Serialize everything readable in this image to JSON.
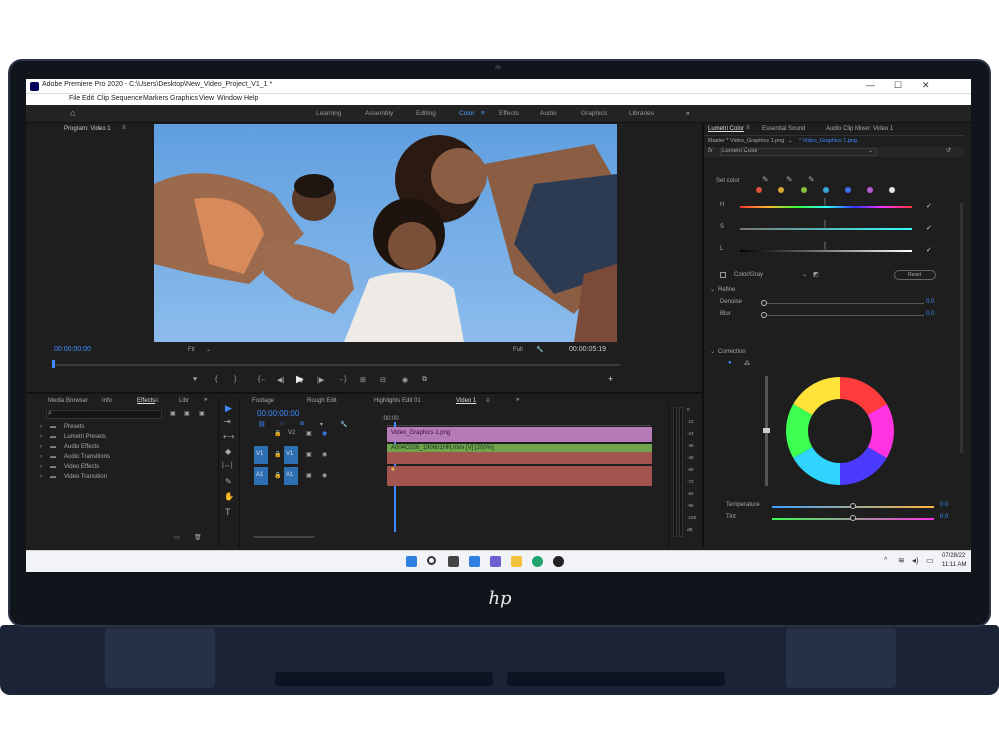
{
  "app": {
    "title": "Adobe Premiere Pro 2020 - C:\\Users\\Desktop\\New_Video_Project_V1_1 *",
    "window_controls": [
      "—",
      "☐",
      "✕"
    ]
  },
  "menu": [
    "File",
    "Edit",
    "Clip",
    "Sequence",
    "Markers",
    "Graphics",
    "View",
    "Window",
    "Help"
  ],
  "workspaces": {
    "items": [
      "Learning",
      "Assembly",
      "Editing",
      "Color",
      "Effects",
      "Audio",
      "Graphics",
      "Libraries"
    ],
    "active": "Color",
    "more": "»"
  },
  "program": {
    "tab": "Program: Video 1",
    "menu_icon": "≡",
    "timecode_in": "00:00:00:00",
    "fit": "Fit",
    "quality": "Full",
    "timecode_out": "00:00:05:19"
  },
  "transport": [
    "♥",
    "{",
    "}",
    "{←",
    "◀|",
    "◀",
    "▶",
    "|▶",
    "→}",
    "⊞",
    "⊟",
    "◉",
    "⧉",
    "+"
  ],
  "project_panel": {
    "tabs": [
      "Media Browser",
      "Info",
      "Effects",
      "Libr"
    ],
    "active_tab": "Effects",
    "more": "»",
    "items": [
      "Presets",
      "Lumetri Presets",
      "Audio Effects",
      "Audio Transitions",
      "Video Effects",
      "Video Transition"
    ]
  },
  "tools": [
    "▶",
    "⇥",
    "⟷",
    "◆",
    "|↔|",
    "✎",
    "✋",
    "T"
  ],
  "timeline": {
    "tabs": [
      "Footage",
      "Rough Edit",
      "Highlights Edit 01",
      "Video 1"
    ],
    "active_tab": "Video 1",
    "more": "»",
    "timecode": "00:00:00:00",
    "ruler_label": ":00:00",
    "track_labels": [
      {
        "src": "",
        "label": "V2"
      },
      {
        "src": "V1",
        "label": "V1"
      },
      {
        "src": "A1",
        "label": "A1"
      }
    ],
    "clips": [
      {
        "name": "Video_Graphics 1.png",
        "color": "#b57ab8"
      },
      {
        "name": "A004C026_190601HN.mov [V] [200%]",
        "color": "#6fa34c"
      },
      {
        "name": "",
        "color": "#a3544f"
      }
    ]
  },
  "meter": {
    "scale": [
      "0",
      "-12",
      "-24",
      "-36",
      "-48",
      "-60",
      "-72",
      "-84",
      "-96",
      "-108",
      "dB"
    ]
  },
  "lumetri": {
    "tabs": [
      "Lumetri Color",
      "Essential Sound",
      "Audio Clip Mixer: Video 1"
    ],
    "active_tab": "Lumetri Color",
    "master": "Master * Video_Graphics 1.png",
    "clip": "* Video_Graphics 1.png",
    "fx_label": "fx",
    "effect_name": "Lumetri Color",
    "set_color": "Set color",
    "swatch_colors": [
      "#e0513d",
      "#d9a537",
      "#86c23e",
      "#3aa8d4",
      "#3f6fe0",
      "#b35bd1",
      "#e7e7e7"
    ],
    "hsl_labels": [
      "H",
      "S",
      "L"
    ],
    "color_gray": "Color/Gray",
    "reset": "Reset",
    "refine": "Refine",
    "denoise": {
      "label": "Denoise",
      "value": "0.0"
    },
    "blur": {
      "label": "Blur",
      "value": "0.0"
    },
    "correction": "Correction",
    "temperature": {
      "label": "Temperature",
      "value": "0.0"
    },
    "tint": {
      "label": "Tint",
      "value": "0.0"
    }
  },
  "taskbar": {
    "icons": [
      "windows-icon",
      "search-icon",
      "task-view-icon",
      "widgets-icon",
      "chat-icon",
      "file-explorer-icon",
      "edge-icon",
      "media-icon"
    ],
    "date": "07/28/22",
    "time": "11:11 AM"
  },
  "brand": "hp",
  "colors": {
    "accent_blue": "#3d8bff",
    "playhead": "#3d8bff",
    "v2_clip": "#b57ab8",
    "v1_clip": "#6fa34c",
    "a1_clip": "#a3544f",
    "laptop": "#1b2436"
  }
}
